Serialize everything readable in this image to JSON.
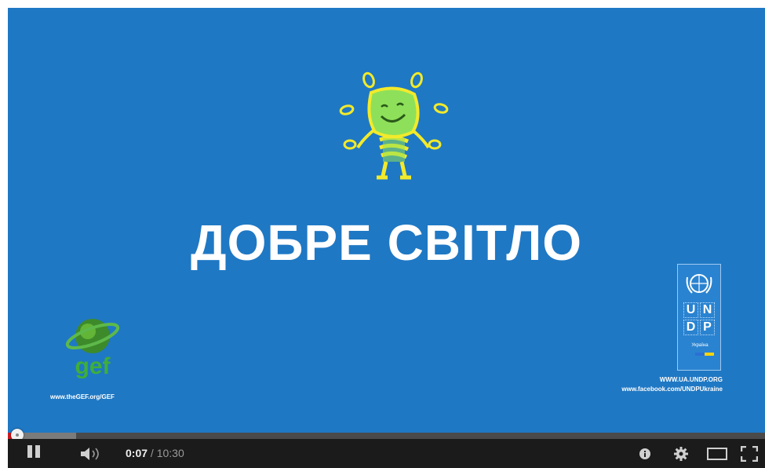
{
  "video": {
    "title": "ДОБРЕ СВІТЛО",
    "background_color": "#1f78c4",
    "gef": {
      "logo_text": "gef",
      "url": "www.theGEF.org/GEF"
    },
    "undp": {
      "letters": [
        "U",
        "N",
        "D",
        "P"
      ],
      "country": "Україна",
      "web_line_1": "WWW.UA.UNDP.ORG",
      "web_line_2": "www.facebook.com/UNDPUkraine"
    }
  },
  "player": {
    "progress_fraction": 0.011,
    "buffered_fraction": 0.09,
    "current_time": "0:07",
    "separator": " / ",
    "duration": "10:30",
    "icons": {
      "pause": "pause-icon",
      "volume": "volume-icon",
      "info": "info-icon",
      "settings": "gear-icon",
      "theater": "theater-mode-icon",
      "fullscreen": "fullscreen-icon"
    },
    "colors": {
      "played": "#cc181e",
      "bar_bg": "#1b1b1b"
    }
  }
}
